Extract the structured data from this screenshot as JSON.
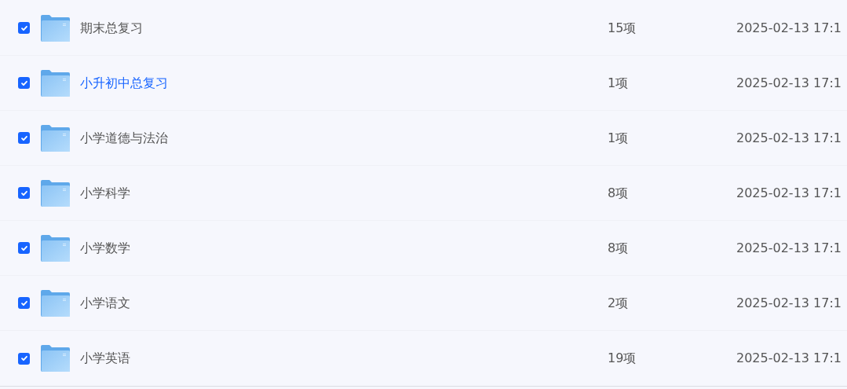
{
  "rows": [
    {
      "name": "期末总复习",
      "count": "15项",
      "date": "2025-02-13 17:1",
      "checked": true,
      "hovered": false
    },
    {
      "name": "小升初中总复习",
      "count": "1项",
      "date": "2025-02-13 17:1",
      "checked": true,
      "hovered": true
    },
    {
      "name": "小学道德与法治",
      "count": "1项",
      "date": "2025-02-13 17:1",
      "checked": true,
      "hovered": false
    },
    {
      "name": "小学科学",
      "count": "8项",
      "date": "2025-02-13 17:1",
      "checked": true,
      "hovered": false
    },
    {
      "name": "小学数学",
      "count": "8项",
      "date": "2025-02-13 17:1",
      "checked": true,
      "hovered": false
    },
    {
      "name": "小学语文",
      "count": "2项",
      "date": "2025-02-13 17:1",
      "checked": true,
      "hovered": false
    },
    {
      "name": "小学英语",
      "count": "19项",
      "date": "2025-02-13 17:1",
      "checked": true,
      "hovered": false
    }
  ]
}
